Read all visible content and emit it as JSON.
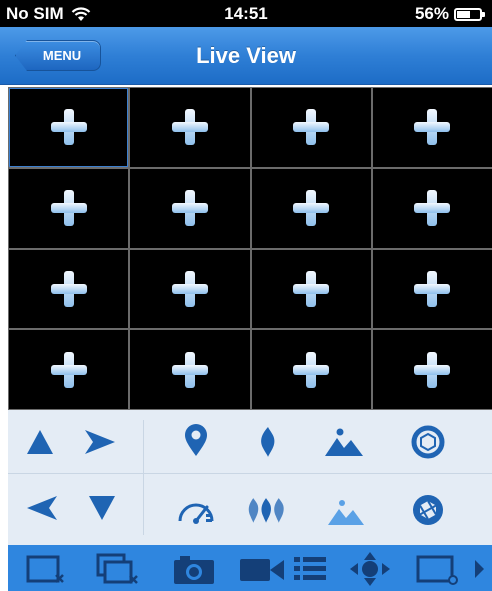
{
  "status_bar": {
    "carrier": "No SIM",
    "time": "14:51",
    "battery": "56%"
  },
  "nav": {
    "menu_label": "MENU",
    "title": "Live View"
  },
  "grid": {
    "rows": 4,
    "columns": 4,
    "selected_cell": 1,
    "cell_icon": "add-camera-plus-icon"
  },
  "ptz_controls": {
    "direction_icons": [
      "arrow-up-icon",
      "arrow-right-icon",
      "arrow-left-icon",
      "arrow-down-icon"
    ],
    "row1_icons": [
      "preset-location-icon",
      "focus-near-icon",
      "zoom-in-mountain-icon",
      "iris-open-icon"
    ],
    "row2_icons": [
      "speed-gauge-icon",
      "focus-far-icon",
      "zoom-out-mountain-icon",
      "iris-close-icon"
    ]
  },
  "toolbar": {
    "icons": [
      "close-channel-icon",
      "close-all-channels-icon",
      "snapshot-camera-icon",
      "record-video-icon",
      "list-icon",
      "ptz-move-icon",
      "multi-screen-icon",
      "more-arrow-icon"
    ]
  },
  "colors": {
    "accent_blue": "#2f86df",
    "icon_blue": "#1f64b3",
    "nav_gradient_top": "#4d9ae8",
    "nav_gradient_bottom": "#1d6cc6",
    "control_bg": "#e4ecf5",
    "grid_bg": "#000000"
  }
}
